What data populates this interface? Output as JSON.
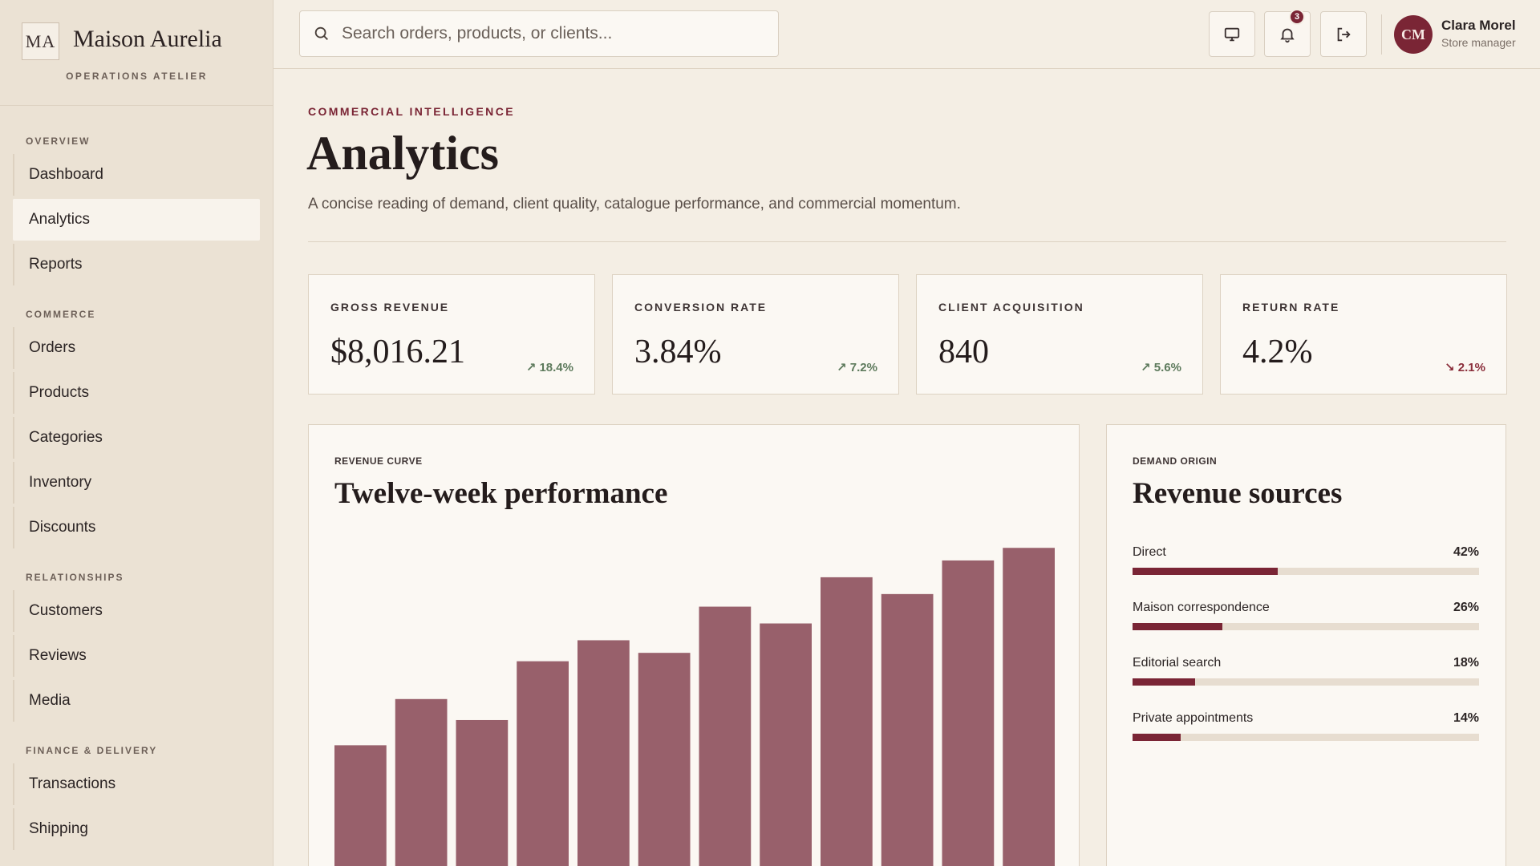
{
  "brand": {
    "mark": "MA",
    "name": "Maison Aurelia",
    "subtitle": "OPERATIONS ATELIER"
  },
  "nav": [
    {
      "section": "OVERVIEW",
      "items": [
        {
          "label": "Dashboard"
        },
        {
          "label": "Analytics",
          "active": true
        },
        {
          "label": "Reports"
        }
      ]
    },
    {
      "section": "COMMERCE",
      "items": [
        {
          "label": "Orders"
        },
        {
          "label": "Products"
        },
        {
          "label": "Categories"
        },
        {
          "label": "Inventory"
        },
        {
          "label": "Discounts"
        }
      ]
    },
    {
      "section": "RELATIONSHIPS",
      "items": [
        {
          "label": "Customers"
        },
        {
          "label": "Reviews"
        },
        {
          "label": "Media"
        }
      ]
    },
    {
      "section": "FINANCE & DELIVERY",
      "items": [
        {
          "label": "Transactions"
        },
        {
          "label": "Shipping"
        }
      ]
    }
  ],
  "topbar": {
    "search_placeholder": "Search orders, products, or clients...",
    "icons": {
      "display": "monitor-icon",
      "notifications": "bell-icon",
      "logout": "logout-icon"
    },
    "notification_count": "3",
    "user": {
      "initials": "CM",
      "name": "Clara Morel",
      "role": "Store manager"
    }
  },
  "header": {
    "eyebrow": "COMMERCIAL INTELLIGENCE",
    "title": "Analytics",
    "description": "A concise reading of demand, client quality, catalogue performance, and commercial momentum."
  },
  "kpis": [
    {
      "label": "GROSS REVENUE",
      "value": "$8,016.21",
      "delta": "18.4%",
      "direction": "up"
    },
    {
      "label": "CONVERSION RATE",
      "value": "3.84%",
      "delta": "7.2%",
      "direction": "up"
    },
    {
      "label": "CLIENT ACQUISITION",
      "value": "840",
      "delta": "5.6%",
      "direction": "up"
    },
    {
      "label": "RETURN RATE",
      "value": "4.2%",
      "delta": "2.1%",
      "direction": "down"
    }
  ],
  "revenue_panel": {
    "eyebrow": "REVENUE CURVE",
    "title": "Twelve-week performance"
  },
  "sources_panel": {
    "eyebrow": "DEMAND ORIGIN",
    "title": "Revenue sources",
    "items": [
      {
        "label": "Direct",
        "pct": "42%",
        "value": 42
      },
      {
        "label": "Maison correspondence",
        "pct": "26%",
        "value": 26
      },
      {
        "label": "Editorial search",
        "pct": "18%",
        "value": 18
      },
      {
        "label": "Private appointments",
        "pct": "14%",
        "value": 14
      }
    ]
  },
  "colors": {
    "accent": "#7a2535",
    "bar": "#98606b",
    "background": "#f4eee4",
    "up": "#5d7a5c",
    "down": "#8a2d3a"
  },
  "chart_data": {
    "type": "bar",
    "title": "Twelve-week performance",
    "categories": [
      "",
      "",
      "",
      "",
      "",
      "",
      "",
      "",
      "",
      "",
      "",
      ""
    ],
    "values": [
      32,
      43,
      38,
      52,
      57,
      54,
      65,
      61,
      72,
      68,
      76,
      79
    ],
    "ylim": [
      0,
      80
    ],
    "grid": false
  }
}
